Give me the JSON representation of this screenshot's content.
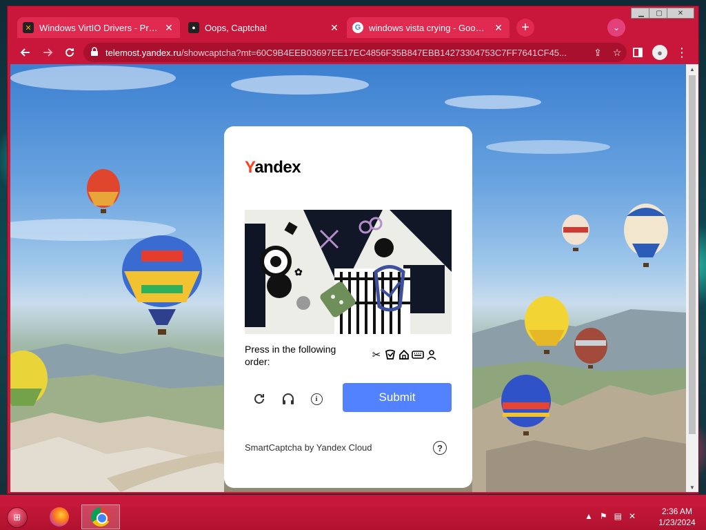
{
  "browser": {
    "tabs": [
      {
        "title": "Windows VirtIO Drivers - Proxmox",
        "favicon": "proxmox-icon",
        "active": false
      },
      {
        "title": "Oops, Captcha!",
        "favicon": "telemost-icon",
        "active": true
      },
      {
        "title": "windows vista crying - Google Search",
        "favicon": "google-icon",
        "active": false
      }
    ],
    "url_domain": "telemost.yandex.ru",
    "url_path": "/showcaptcha?mt=60C9B4EEB03697EE17EC4856F35B847EBB14273304753C7FF7641CF45...",
    "accent_color": "#c8173a"
  },
  "captcha": {
    "logo_first": "Y",
    "logo_rest": "andex",
    "instruction": "Press in the following order:",
    "order_icons": [
      "scissors-icon",
      "cup-icon",
      "house-icon",
      "keyboard-icon",
      "person-icon"
    ],
    "submit_label": "Submit",
    "footer": "SmartCaptcha by Yandex Cloud",
    "submit_color": "#5282ff"
  },
  "taskbar": {
    "time": "2:36 AM",
    "date": "1/23/2024",
    "apps": [
      "firefox-icon",
      "chrome-icon"
    ]
  }
}
